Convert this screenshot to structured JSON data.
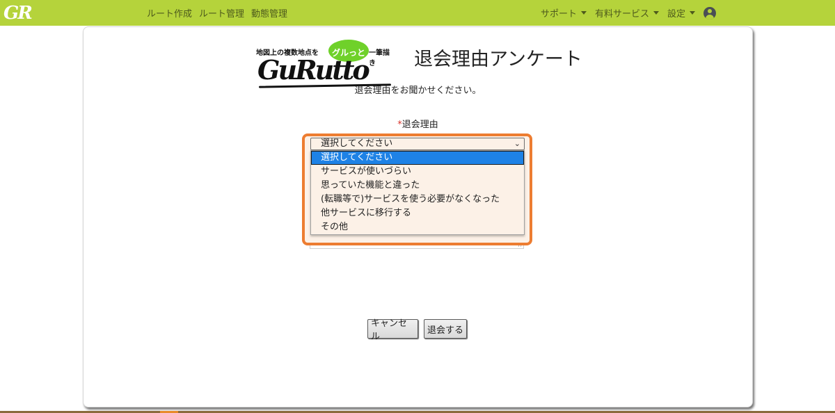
{
  "navbar": {
    "brand": "GR",
    "links": [
      "ルート作成",
      "ルート管理",
      "動態管理"
    ],
    "menus": [
      "サポート",
      "有料サービス",
      "設定"
    ]
  },
  "logo": {
    "tagline_left": "地図上の複数地点を",
    "tagline_bubble": "グルっと",
    "tagline_right": "一筆描き",
    "wordmark": "GuRutto"
  },
  "page": {
    "title": "退会理由アンケート",
    "intro": "退会理由をお聞かせください。"
  },
  "form": {
    "required_mark": "*",
    "reason_label": "退会理由",
    "selected_value": "選択してください",
    "options": [
      "選択してください",
      "サービスが使いづらい",
      "思っていた機能と違った",
      "(転職等で)サービスを使う必要がなくなった",
      "他サービスに移行する",
      "その他"
    ],
    "cancel_label": "キャンセル",
    "submit_label": "退会する"
  },
  "colors": {
    "navbar": "#b5d33b",
    "highlight": "#ed7d31",
    "selected_option": "#1e82e6"
  },
  "icons": {
    "user": "user-circle-icon",
    "caret": "caret-down-icon"
  }
}
